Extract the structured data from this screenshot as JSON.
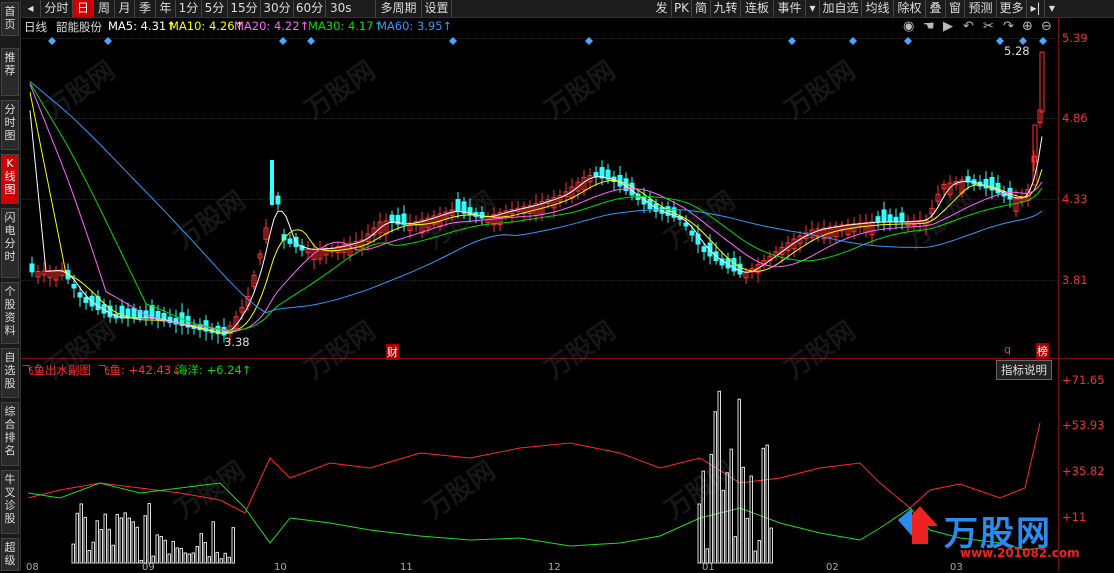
{
  "sidebar": [
    {
      "label": "首页",
      "active": false
    },
    {
      "label": "推荐",
      "active": false
    },
    {
      "label": "分时图",
      "active": false
    },
    {
      "label": "K线图",
      "active": true
    },
    {
      "label": "闪电分时",
      "active": false
    },
    {
      "label": "个股资料",
      "active": false
    },
    {
      "label": "自选股",
      "active": false
    },
    {
      "label": "综合排名",
      "active": false
    },
    {
      "label": "牛叉诊股",
      "active": false
    },
    {
      "label": "超级",
      "active": false
    }
  ],
  "toolbar": {
    "left": [
      "分时",
      "日",
      "周",
      "月",
      "季",
      "年",
      "1分",
      "5分",
      "15分",
      "30分",
      "60分",
      "30s",
      "多周期",
      "设置"
    ],
    "right": [
      "发",
      "PK",
      "简",
      "九转",
      "连板",
      "事件",
      "加自选",
      "均线",
      "除权",
      "叠",
      "窗",
      "预测",
      "更多"
    ]
  },
  "info": {
    "period": "日线",
    "stock": "韶能股份",
    "ma5": "MA5: 4.31↑",
    "ma10": "MA10: 4.26↑",
    "ma20": "MA20: 4.22↑",
    "ma30": "MA30: 4.17↑",
    "ma60": "MA60: 3.95↑"
  },
  "colors": {
    "ma5": "#ffffff",
    "ma10": "#ffff00",
    "ma20": "#ff66ff",
    "ma30": "#00dd00",
    "ma60": "#3399ff",
    "up": "#ff3333",
    "down": "#33ffff"
  },
  "price_axis": [
    "5.39",
    "4.86",
    "4.33",
    "3.81"
  ],
  "annotations": {
    "high": "5.28",
    "low": "3.38",
    "cai": "财",
    "q": "q",
    "bang": "榜"
  },
  "sub": {
    "title": "飞鱼出水副图",
    "fish": "飞鱼: +42.43↓",
    "ocean": "海洋: +6.24↑",
    "explain": "指标说明",
    "axis": [
      "+71.65",
      "+53.93",
      "+35.82",
      "+11"
    ]
  },
  "months": [
    "08",
    "09",
    "10",
    "11",
    "12",
    "01",
    "02",
    "03"
  ],
  "watermark": {
    "brand": "万股网",
    "url": "www.201082.com"
  }
}
